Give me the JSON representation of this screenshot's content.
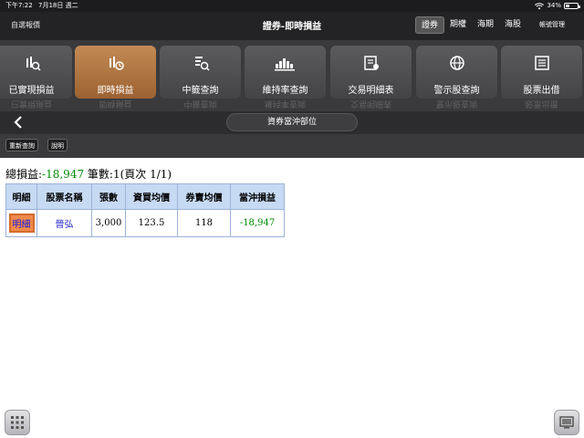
{
  "status": {
    "time": "下午7:22",
    "date": "7月18日 週二",
    "battery_text": "34%",
    "battery_level": 0.34
  },
  "header": {
    "left_link": "自選報價",
    "title": "證券-即時損益",
    "segments": [
      {
        "label": "證券",
        "active": true
      },
      {
        "label": "期權",
        "active": false
      },
      {
        "label": "海期",
        "active": false
      },
      {
        "label": "海股",
        "active": false
      }
    ],
    "account": "帳號管理"
  },
  "functions": [
    {
      "label": "已實現損益",
      "icon": "realized-pl-icon",
      "active": false
    },
    {
      "label": "即時損益",
      "icon": "realtime-pl-icon",
      "active": true
    },
    {
      "label": "中籤查詢",
      "icon": "lottery-query-icon",
      "active": false
    },
    {
      "label": "維持率查詢",
      "icon": "margin-ratio-icon",
      "active": false
    },
    {
      "label": "交易明細表",
      "icon": "trade-detail-icon",
      "active": false
    },
    {
      "label": "警示股查詢",
      "icon": "warning-stock-icon",
      "active": false
    },
    {
      "label": "股票出借",
      "icon": "stock-lending-icon",
      "active": false
    }
  ],
  "subbar": {
    "title": "資券當沖部位"
  },
  "toolbar": {
    "refresh": "重新查詢",
    "help": "說明"
  },
  "summary": {
    "total_label": "總損益:",
    "total_value": "-18,947",
    "count_label": "筆數:1(頁次 1/1)"
  },
  "table": {
    "columns": [
      "明細",
      "股票名稱",
      "張數",
      "資買均價",
      "券賣均價",
      "當沖損益"
    ],
    "rows": [
      {
        "detail": "明細",
        "name": "晉弘",
        "qty": "3,000",
        "buy_avg": "123.5",
        "sell_avg": "118",
        "pl": "-18,947"
      }
    ]
  }
}
